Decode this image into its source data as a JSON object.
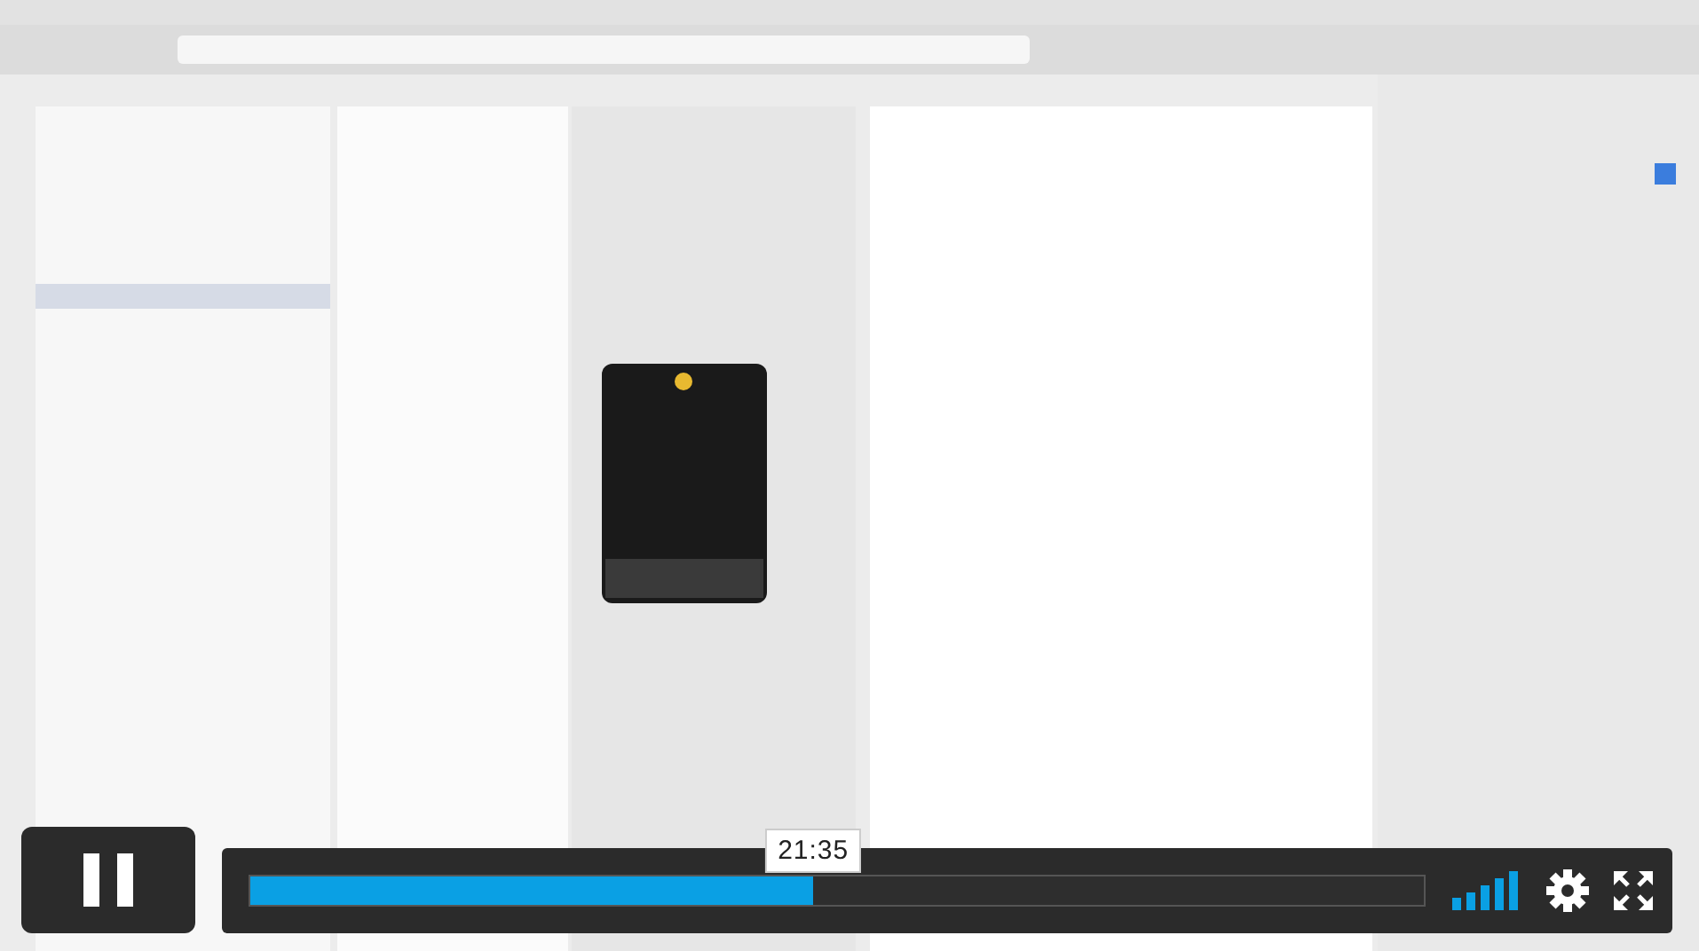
{
  "player": {
    "playing": true,
    "progress": {
      "level": 0.479,
      "tooltip": "21:35"
    }
  }
}
